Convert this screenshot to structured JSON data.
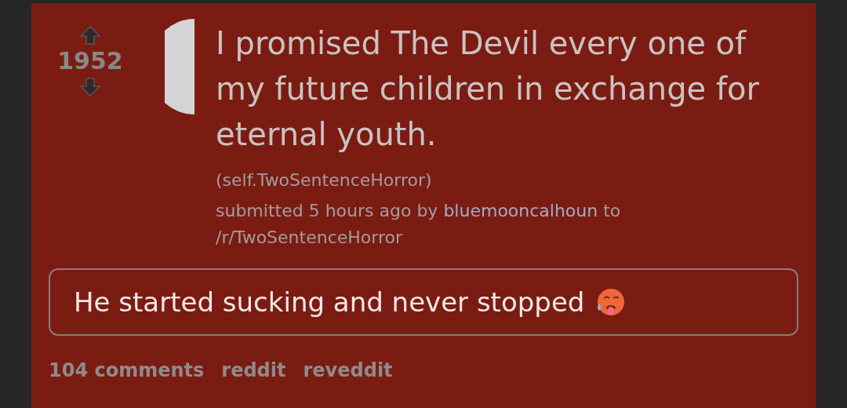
{
  "post": {
    "score": "1952",
    "title": "I promised The Devil every one of my future children in exchange for eternal youth.",
    "domain": "(self.TwoSentenceHorror)",
    "submitted_prefix": "submitted 5 hours ago by",
    "author": "bluemooncalhoun",
    "submitted_suffix": "to",
    "subreddit": "/r/TwoSentenceHorror",
    "body": "He started sucking and never stopped",
    "links": [
      "104 comments",
      "reddit",
      "reveddit"
    ]
  }
}
